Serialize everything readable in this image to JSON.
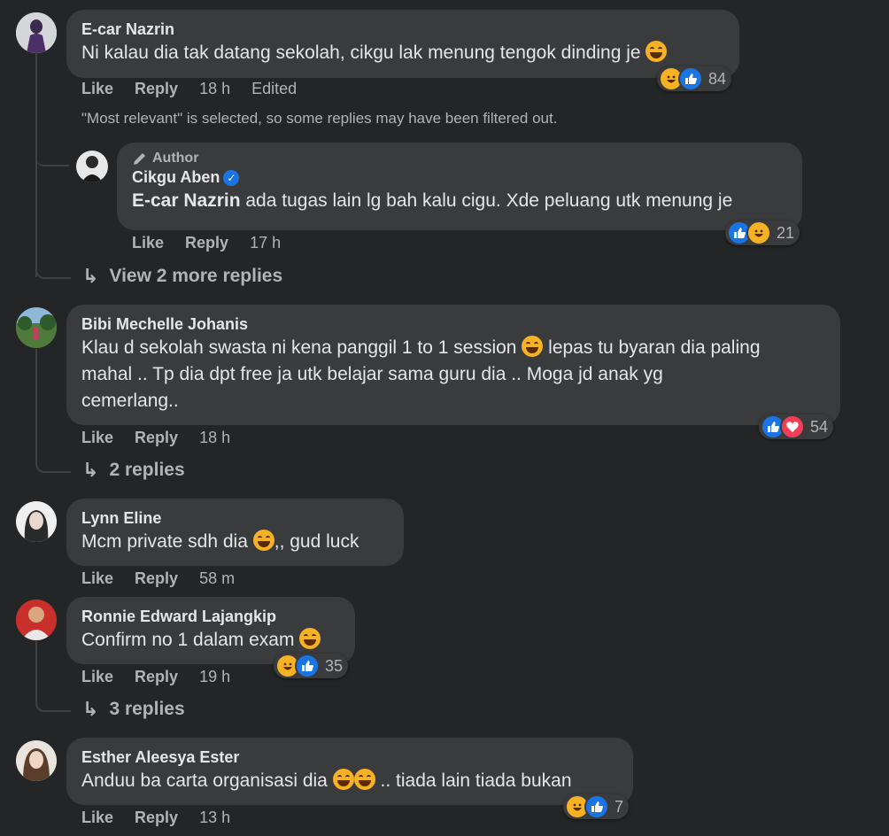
{
  "actions": {
    "like": "Like",
    "reply": "Reply"
  },
  "notice": "\"Most relevant\" is selected, so some replies may have been filtered out.",
  "colors": {
    "background": "#242526",
    "bubble": "#3a3b3c",
    "secondary_text": "#b0b3b8",
    "like_blue": "#1b74e4",
    "haha_yellow": "#f7b125",
    "love_red": "#f33e58"
  },
  "comments": [
    {
      "name": "E-car Nazrin",
      "text": "Ni kalau dia tak datang sekolah, cikgu lak menung tengok dinding je",
      "time": "18 h",
      "edited": "Edited",
      "reactions": {
        "icons": [
          "haha",
          "like"
        ],
        "count": "84"
      }
    },
    {
      "author_label": "Author",
      "name": "Cikgu Aben",
      "mention": "E-car Nazrin",
      "text": " ada tugas lain lg bah kalu cigu. Xde peluang utk menung je",
      "time": "17 h",
      "reactions": {
        "icons": [
          "like",
          "haha"
        ],
        "count": "21"
      }
    },
    {
      "view_replies": "View 2 more replies"
    },
    {
      "name": "Bibi Mechelle Johanis",
      "text_a": "Klau d sekolah swasta ni kena panggil 1 to 1 session",
      "text_b": " lepas tu byaran dia paling",
      "text_c": "mahal .. Tp dia dpt free ja utk belajar sama guru dia .. Moga jd anak yg",
      "text_d": "cemerlang..",
      "time": "18 h",
      "reactions": {
        "icons": [
          "like",
          "love"
        ],
        "count": "54"
      }
    },
    {
      "view_replies": "2 replies"
    },
    {
      "name": "Lynn Eline",
      "text_a": "Mcm private sdh dia",
      "text_b": ",, gud luck",
      "time": "58 m"
    },
    {
      "name": "Ronnie Edward Lajangkip",
      "text": "Confirm no 1 dalam exam",
      "time": "19 h",
      "reactions": {
        "icons": [
          "haha",
          "like"
        ],
        "count": "35"
      }
    },
    {
      "view_replies": "3 replies"
    },
    {
      "name": "Esther Aleesya Ester",
      "text_a": "Anduu ba carta organisasi dia",
      "text_b": " .. tiada lain tiada bukan",
      "time": "13 h",
      "reactions": {
        "icons": [
          "haha",
          "like"
        ],
        "count": "7"
      }
    }
  ]
}
